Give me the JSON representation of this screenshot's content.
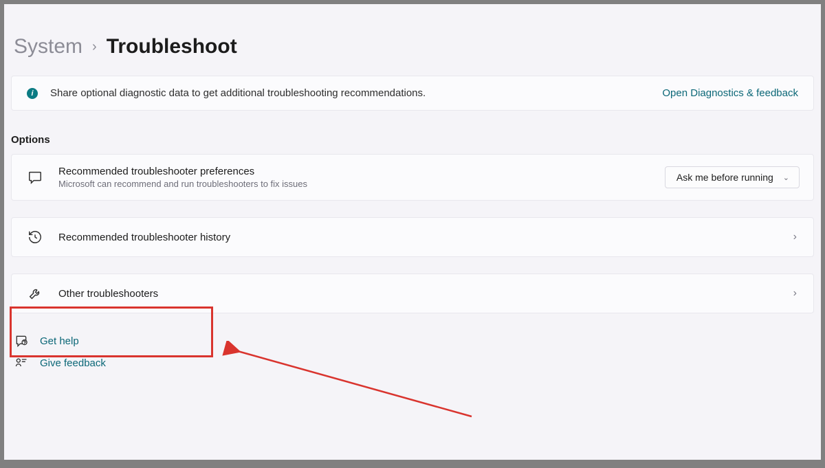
{
  "breadcrumb": {
    "parent": "System",
    "current": "Troubleshoot"
  },
  "banner": {
    "text": "Share optional diagnostic data to get additional troubleshooting recommendations.",
    "link": "Open Diagnostics & feedback"
  },
  "sections": {
    "options_label": "Options"
  },
  "rows": {
    "prefs": {
      "title": "Recommended troubleshooter preferences",
      "subtitle": "Microsoft can recommend and run troubleshooters to fix issues",
      "dropdown_value": "Ask me before running"
    },
    "history": {
      "title": "Recommended troubleshooter history"
    },
    "other": {
      "title": "Other troubleshooters"
    }
  },
  "footer": {
    "help": "Get help",
    "feedback": "Give feedback"
  }
}
